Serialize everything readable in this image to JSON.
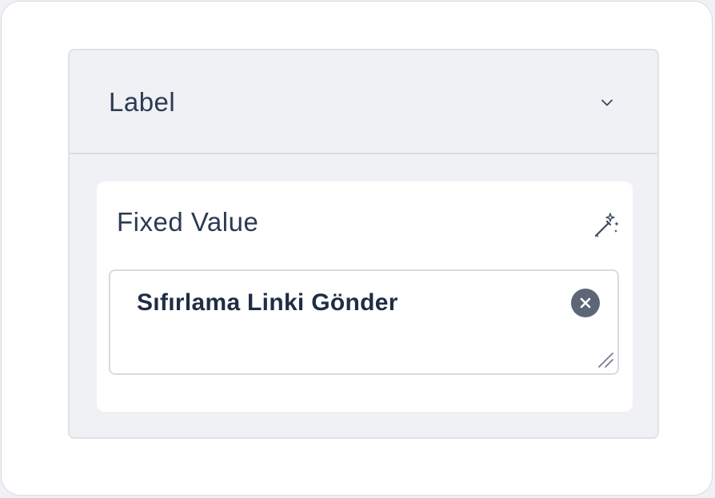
{
  "section": {
    "title": "Label",
    "toggle_icon": "chevron-down-icon"
  },
  "field": {
    "label": "Fixed Value",
    "magic_icon": "magic-wand-icon",
    "value": "Sıfırlama Linki Gönder",
    "clear_icon": "close-icon",
    "resize_icon": "resize-handle-icon"
  },
  "colors": {
    "text": "#2c3a52",
    "value_text": "#1f2d44",
    "panel_bg": "#eff1f4",
    "card_bg": "#ffffff",
    "clear_button": "#5c6677"
  }
}
